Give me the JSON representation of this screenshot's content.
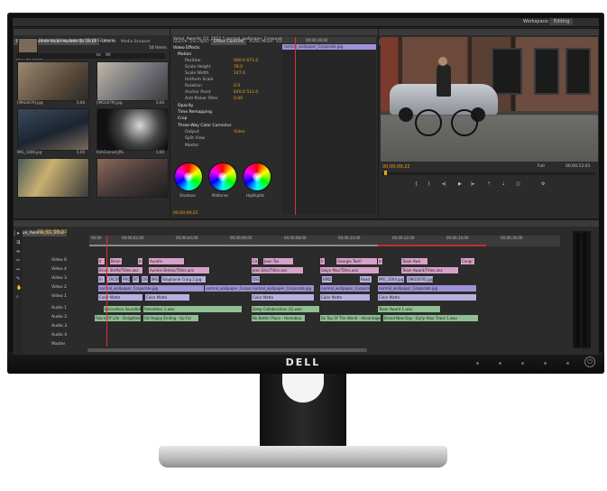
{
  "workspace": {
    "label": "Workspace:",
    "value": "Editing"
  },
  "project_panel": {
    "tabs": [
      "Project: Illumine Value Awards Q1 2012",
      "Effects",
      "Media Browser",
      "Bin: Q1 2012"
    ],
    "project_name": "Illumine Value Awards Q1 2012.prproj",
    "item_count": "16 Items",
    "in_label": "In:",
    "in_value": "All",
    "thumbnails": [
      {
        "name": "[IMG0079].jpg",
        "duration": "5;00"
      },
      {
        "name": "[IMG0079].jpg",
        "duration": "5;00"
      },
      {
        "name": "IMG_1006.jpg",
        "duration": "5;00"
      },
      {
        "name": "KimConrad.JPG",
        "duration": "5;00"
      },
      {
        "name": "",
        "duration": ""
      },
      {
        "name": "",
        "duration": ""
      }
    ]
  },
  "effect_controls": {
    "tabs": [
      "Source: (no clips)",
      "Effect Controls",
      "Audio Mixer: Value_Awards_Q1_2012",
      "Metadata"
    ],
    "clip_title": "Value_Awards_Q1_2012 * normal_wallpaper_Corporate.jpg",
    "section": "Video Effects",
    "rows": [
      {
        "label": "Motion",
        "value": ""
      },
      {
        "label": "Position",
        "value": "960.0   671.0"
      },
      {
        "label": "Scale Height",
        "value": "78.0"
      },
      {
        "label": "Scale Width",
        "value": "147.0"
      },
      {
        "label": "Uniform Scale",
        "value": ""
      },
      {
        "label": "Rotation",
        "value": "0.0"
      },
      {
        "label": "Anchor Point",
        "value": "640.0   512.0"
      },
      {
        "label": "Anti-flicker Filter",
        "value": "0.00"
      },
      {
        "label": "Opacity",
        "value": ""
      },
      {
        "label": "Time Remapping",
        "value": ""
      },
      {
        "label": "Crop",
        "value": ""
      },
      {
        "label": "Three-Way Color Corrector",
        "value": ""
      },
      {
        "label": "Output",
        "value": "Video"
      },
      {
        "label": "Split View",
        "value": ""
      },
      {
        "label": "Master",
        "value": ""
      }
    ],
    "wheels": [
      "Shadows",
      "Midtones",
      "Highlights"
    ],
    "timecode": "00;00;09;22",
    "mini_ruler": "00;00;16;00",
    "mini_clip": "normal_wallpaper_Corporate.jpg"
  },
  "program_monitor": {
    "tab": "Program: Value_Awards_Q1_2012",
    "timecode": "00;00;09;22",
    "fit": "Full",
    "duration": "00;00;12;01"
  },
  "timeline": {
    "tab": "Value_Awards_Q1_2012",
    "timecode": "00;00;09;22",
    "ruler_ticks": [
      "00;00",
      "00;00;02;00",
      "00;00;04;00",
      "00;00;06;00",
      "00;00;08;00",
      "00;00;10;00",
      "00;00;12;00",
      "00;00;14;00",
      "00;00;16;00"
    ],
    "tracks": [
      {
        "label": "Video 6",
        "clips": [
          {
            "text": "Ir",
            "color": "pink"
          },
          {
            "text": "Brian",
            "color": "pink"
          },
          {
            "text": "In",
            "color": "pink"
          },
          {
            "text": "Aurelie",
            "color": "pink"
          },
          {
            "text": "Ce",
            "color": "pink"
          },
          {
            "text": "Jean Tex",
            "color": "pink"
          },
          {
            "text": "Ir",
            "color": "pink"
          },
          {
            "text": "Georgie Text?",
            "color": "pink"
          },
          {
            "text": "In",
            "color": "pink"
          },
          {
            "text": "Team Awe",
            "color": "pink"
          },
          {
            "text": "Congr",
            "color": "pink"
          }
        ]
      },
      {
        "label": "Video 4",
        "clips": [
          {
            "text": "Brian Steffs/Titles.aez",
            "color": "pink"
          },
          {
            "text": "Aurelie Breton/Titles.aez",
            "color": "pink"
          },
          {
            "text": "Jean Elks/Titles.aez",
            "color": "pink"
          },
          {
            "text": "Gwyn Mac/Titles.aez",
            "color": "pink"
          },
          {
            "text": "Team Award/Titles.aez",
            "color": "pink"
          }
        ]
      },
      {
        "label": "Video 3",
        "clips": [
          {
            "text": "In",
            "color": "lav"
          },
          {
            "text": "2RC0N",
            "color": "lav"
          },
          {
            "text": "PRO",
            "color": "lav"
          },
          {
            "text": "BT",
            "color": "lav"
          },
          {
            "text": "DSC",
            "color": "lav"
          },
          {
            "text": "IMG",
            "color": "lav"
          },
          {
            "text": "Stephanie Craig 2.jpg",
            "color": "lav"
          },
          {
            "text": "DSC",
            "color": "lav"
          },
          {
            "text": "KMD",
            "color": "lav"
          },
          {
            "text": "Read",
            "color": "lav"
          },
          {
            "text": "IMG_1004.jpg",
            "color": "lav"
          },
          {
            "text": "[IMG0078].jpg",
            "color": "lav"
          }
        ]
      },
      {
        "label": "Video 2",
        "clips": [
          {
            "text": "normal_wallpaper_Corporate.jpg",
            "color": "purple"
          },
          {
            "text": "normal_wallpaper_Corporate.jpg",
            "color": "purple"
          },
          {
            "text": "normal_wallpaper_Corporate.jpg",
            "color": "purple"
          },
          {
            "text": "normal_wallpaper_Corporate.jpg",
            "color": "purple"
          },
          {
            "text": "normal_wallpaper_Corporate.jpg",
            "color": "purple"
          }
        ]
      },
      {
        "label": "Video 1",
        "clips": [
          {
            "text": "Color Matte",
            "color": "lav"
          },
          {
            "text": "Color Matte",
            "color": "lav"
          },
          {
            "text": "Color Matte",
            "color": "lav"
          },
          {
            "text": "Color Matte",
            "color": "lav"
          },
          {
            "text": "Color Matte",
            "color": "lav"
          }
        ]
      },
      {
        "label": "Audio 1",
        "clips": [
          {
            "text": "Innovation Soundbite",
            "color": "green"
          },
          {
            "text": "Relentless 1.wav",
            "color": "green"
          },
          {
            "text": "Deep Collaboration (2).wav",
            "color": "green"
          },
          {
            "text": "Team Award 1.wav",
            "color": "green"
          }
        ]
      },
      {
        "label": "Audio 2",
        "clips": [
          {
            "text": "Fabric Of Life - Delighted",
            "color": "green"
          },
          {
            "text": "Fat Happy Ending - Up For",
            "color": "green"
          },
          {
            "text": "No Better Place - Homebou",
            "color": "green"
          },
          {
            "text": "So Top Of The World - Advantage",
            "color": "green"
          },
          {
            "text": "Brand New Day - Early Hour Track 1.wav",
            "color": "green"
          }
        ]
      },
      {
        "label": "Audio 3",
        "clips": []
      },
      {
        "label": "Audio 4",
        "clips": []
      },
      {
        "label": "Master",
        "clips": []
      }
    ]
  },
  "brand": "DELL",
  "colors": {
    "pink": "#d8a1c9",
    "purple": "#9f92d6",
    "lav": "#b8b0e0",
    "green": "#8fbf93",
    "timecode": "#e8a317"
  }
}
